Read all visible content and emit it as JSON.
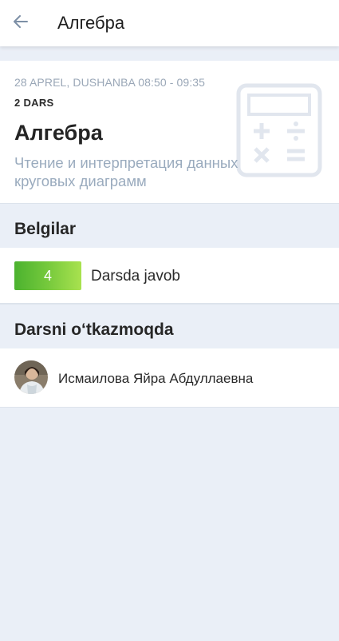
{
  "header": {
    "title": "Алгебра",
    "back_icon": "arrow-left-icon"
  },
  "lesson": {
    "date_time": "28 APREL, DUSHANBA 08:50 - 09:35",
    "lesson_number": "2 DARS",
    "subject": "Алгебра",
    "topic": "Чтение и интерпретация данных круговых диаграмм",
    "subject_icon": "calculator-icon"
  },
  "marks_section": {
    "title": "Belgilar",
    "items": [
      {
        "grade": "4",
        "label": "Darsda javob",
        "badge_color": "#6cc23b"
      }
    ]
  },
  "teacher_section": {
    "title": "Darsni o‘tkazmoqda",
    "teacher_name": "Исмаилова Яйра Абдуллаевна"
  },
  "colors": {
    "background": "#eaeff7",
    "card": "#ffffff",
    "muted_text": "#9aa7b7",
    "accent_grade": "#6cc23b"
  }
}
